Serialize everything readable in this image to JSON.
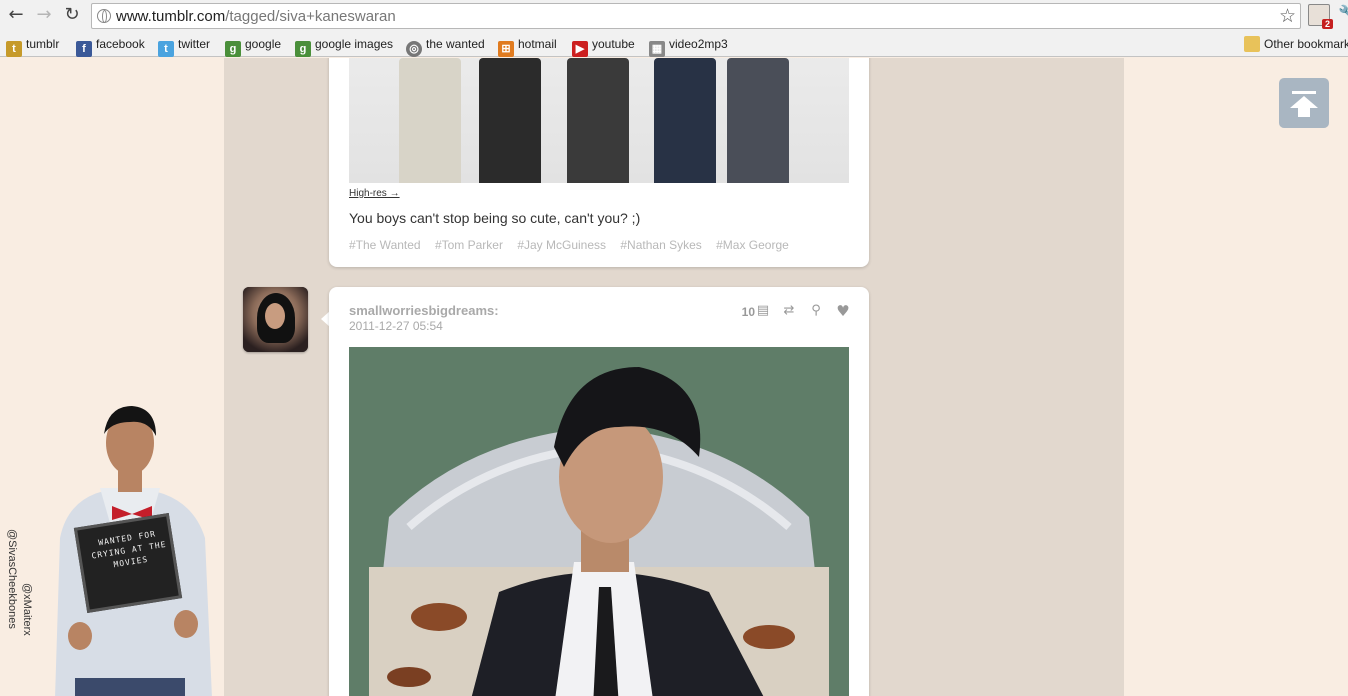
{
  "browser": {
    "url_host": "www.tumblr.com",
    "url_path": "/tagged/siva+kaneswaran",
    "extension_badge": "2",
    "bookmarks": [
      {
        "label": "tumblr",
        "icon": "tumblr-icon",
        "color": "#c69a2a"
      },
      {
        "label": "facebook",
        "icon": "facebook-icon",
        "color": "#3b5998"
      },
      {
        "label": "twitter",
        "icon": "twitter-bird-icon",
        "color": "#4aa3df"
      },
      {
        "label": "google",
        "icon": "google-icon",
        "color": "#4a8f3a"
      },
      {
        "label": "google images",
        "icon": "google-icon",
        "color": "#4a8f3a"
      },
      {
        "label": "the wanted",
        "icon": "globe-icon",
        "color": "#777777"
      },
      {
        "label": "hotmail",
        "icon": "windows-icon",
        "color": "#e07b1f"
      },
      {
        "label": "youtube",
        "icon": "youtube-icon",
        "color": "#cc1f1f"
      },
      {
        "label": "video2mp3",
        "icon": "video2mp3-icon",
        "color": "#888888"
      }
    ],
    "other_bookmarks": "Other bookmarks"
  },
  "post1": {
    "hires_label": "High-res →",
    "caption": "You boys can't stop being so cute, can't you? ;)",
    "tags": [
      "#The Wanted",
      "#Tom Parker",
      "#Jay McGuiness",
      "#Nathan Sykes",
      "#Max George"
    ]
  },
  "post2": {
    "username": "smallworriesbigdreams:",
    "date": "2011-12-27 05:54",
    "notes_count": "10"
  },
  "sidebar": {
    "credit_1": "@SivasCheekbones",
    "credit_2": "@xMaiterx",
    "sign_text": "WANTED FOR CRYING AT THE MOVIES"
  },
  "colors": {
    "page_bg": "#f9ede2",
    "column_bg": "#e2d8ce",
    "scroll_top_button": "#a9b6c2"
  }
}
